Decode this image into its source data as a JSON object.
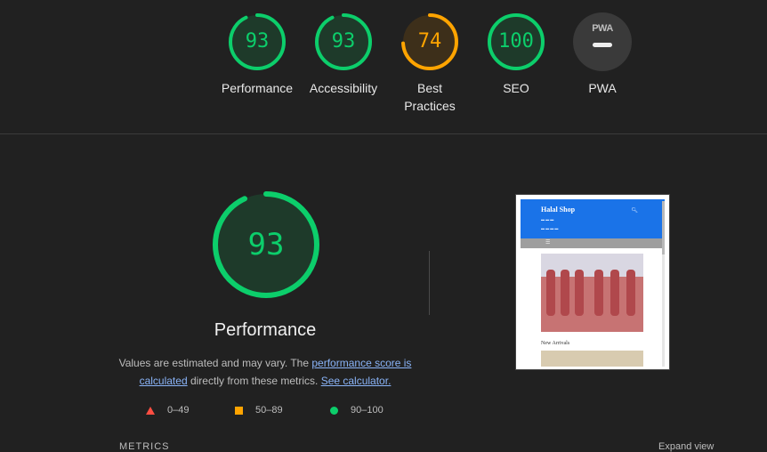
{
  "gauges": [
    {
      "label": "Performance",
      "score": "93",
      "value": 93,
      "color": "#0cce6b",
      "bg": "#1e3a2a"
    },
    {
      "label": "Accessibility",
      "score": "93",
      "value": 93,
      "color": "#0cce6b",
      "bg": "#1e3a2a"
    },
    {
      "label": "Best Practices",
      "line1": "Best",
      "line2": "Practices",
      "score": "74",
      "value": 74,
      "color": "#ffa400",
      "bg": "#3d2f1a"
    },
    {
      "label": "SEO",
      "score": "100",
      "value": 100,
      "color": "#0cce6b",
      "bg": "#1e3a2a"
    },
    {
      "label": "PWA",
      "icon_text": "PWA",
      "icon": "pwa-dash-icon"
    }
  ],
  "main": {
    "score": "93",
    "value": 93,
    "title": "Performance",
    "desc_prefix": "Values are estimated and may vary. The",
    "link1": "performance score is calculated",
    "desc_mid": "directly from these metrics.",
    "link2": "See calculator."
  },
  "legend": [
    {
      "range": "0–49",
      "icon": "triangle-icon",
      "color": "#ff4e42"
    },
    {
      "range": "50–89",
      "icon": "square-icon",
      "color": "#ffa400"
    },
    {
      "range": "90–100",
      "icon": "circle-icon",
      "color": "#0cce6b"
    }
  ],
  "screenshot": {
    "brand": "Halal Shop",
    "section": "New Arrivals"
  },
  "cutoff": {
    "left": "METRICS",
    "right": "Expand view"
  }
}
